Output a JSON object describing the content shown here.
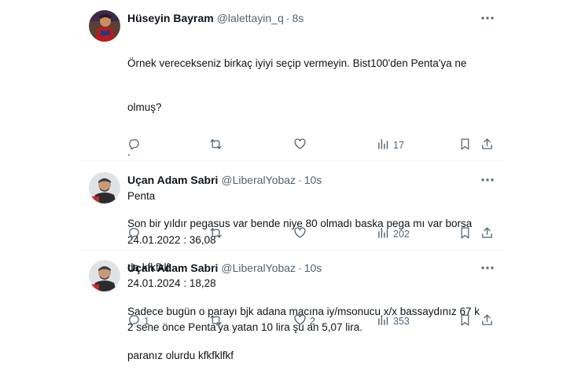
{
  "tweets": [
    {
      "name": "Hüseyin Bayram",
      "handle": "@lalettayin_q",
      "time": "8s",
      "lines": [
        "Örnek verecekseniz birkaç iyiyi seçip vermeyin. Bist100'den Penta'ya ne",
        "olmuş?",
        ".",
        "Penta",
        "24.01.2022 : 36,08",
        "24.01.2024 : 18,28",
        "2 sene önce Penta'ya yatan 10 lira şu an 5,07 lira."
      ],
      "replies": "",
      "retweets": "",
      "likes": "",
      "views": "17"
    },
    {
      "name": "Uçan Adam Sabri",
      "handle": "@LiberalYobaz",
      "time": "10s",
      "lines": [
        "Son bir yıldır pegasus var bende niye 80 olmadı baska pega mı var borsa",
        "da kfkfklf"
      ],
      "replies": "",
      "retweets": "",
      "likes": "",
      "views": "202"
    },
    {
      "name": "Uçan Adam Sabri",
      "handle": "@LiberalYobaz",
      "time": "10s",
      "lines": [
        "Sadece bugün o parayı bjk adana macına iy/msonucu x/x bassaydınız 67 k",
        "paranız olurdu kfkfklfkf"
      ],
      "replies": "1",
      "retweets": "",
      "likes": "2",
      "views": "353"
    }
  ],
  "icons": {
    "reply": "reply-icon",
    "retweet": "retweet-icon",
    "like": "like-icon",
    "views": "views-icon",
    "bookmark": "bookmark-icon",
    "share": "share-icon",
    "more": "more-icon"
  },
  "colors": {
    "text": "#0f1419",
    "secondary": "#536471",
    "divider": "#eff3f4"
  }
}
